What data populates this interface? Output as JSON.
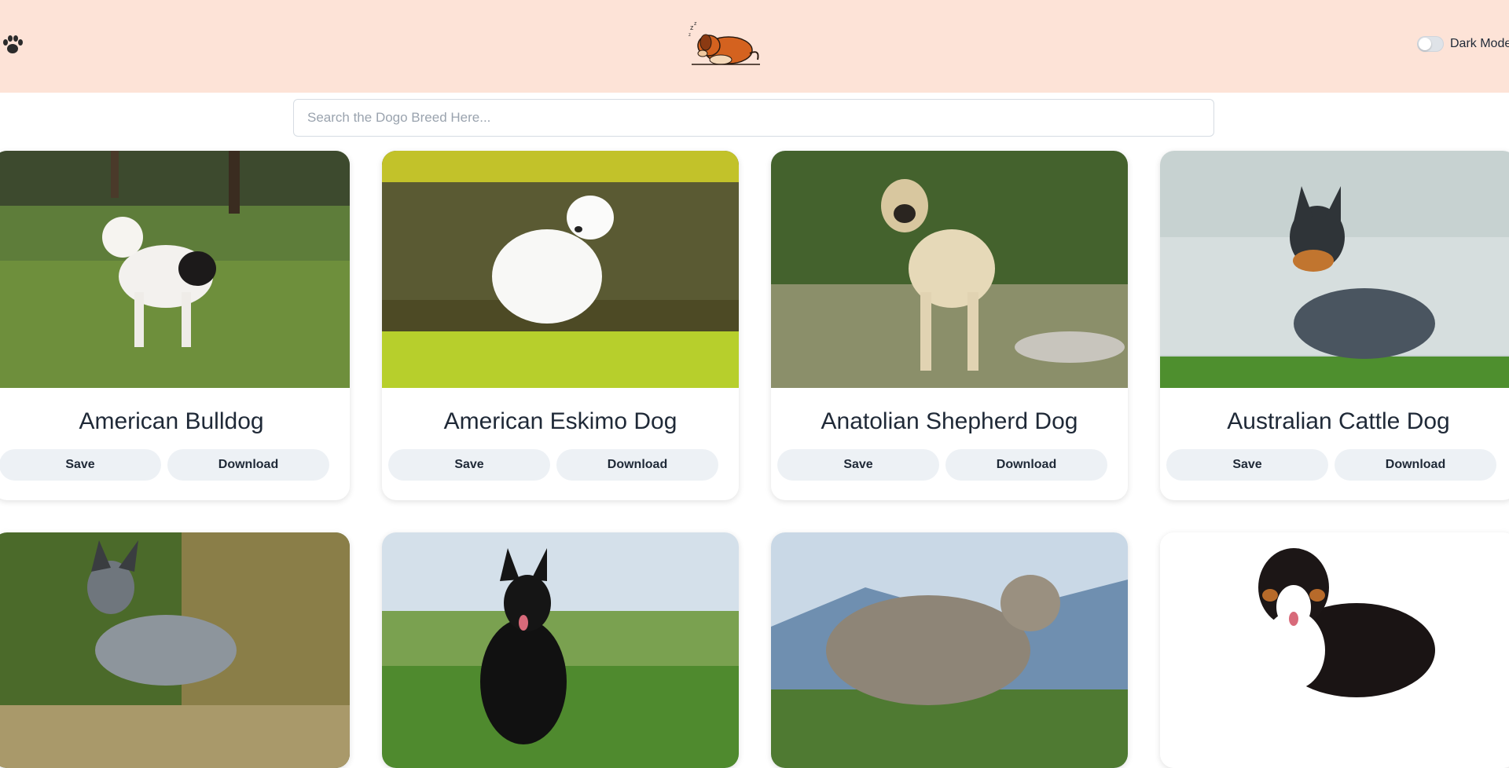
{
  "header": {
    "paw_icon": "paw-icon",
    "logo": "sleeping-dog-logo",
    "dark_mode_label": "Dark Mode",
    "dark_mode_on": false
  },
  "search": {
    "placeholder": "Search the Dogo Breed Here...",
    "value": ""
  },
  "cards": [
    {
      "title": "American Bulldog",
      "save_label": "Save",
      "download_label": "Download"
    },
    {
      "title": "American Eskimo Dog",
      "save_label": "Save",
      "download_label": "Download"
    },
    {
      "title": "Anatolian Shepherd Dog",
      "save_label": "Save",
      "download_label": "Download"
    },
    {
      "title": "Australian Cattle Dog",
      "save_label": "Save",
      "download_label": "Download"
    },
    {
      "title": "",
      "save_label": "",
      "download_label": ""
    },
    {
      "title": "",
      "save_label": "",
      "download_label": ""
    },
    {
      "title": "",
      "save_label": "",
      "download_label": ""
    },
    {
      "title": "",
      "save_label": "",
      "download_label": ""
    }
  ],
  "colors": {
    "header_bg": "#fde3d7",
    "button_bg": "#edf1f5"
  }
}
